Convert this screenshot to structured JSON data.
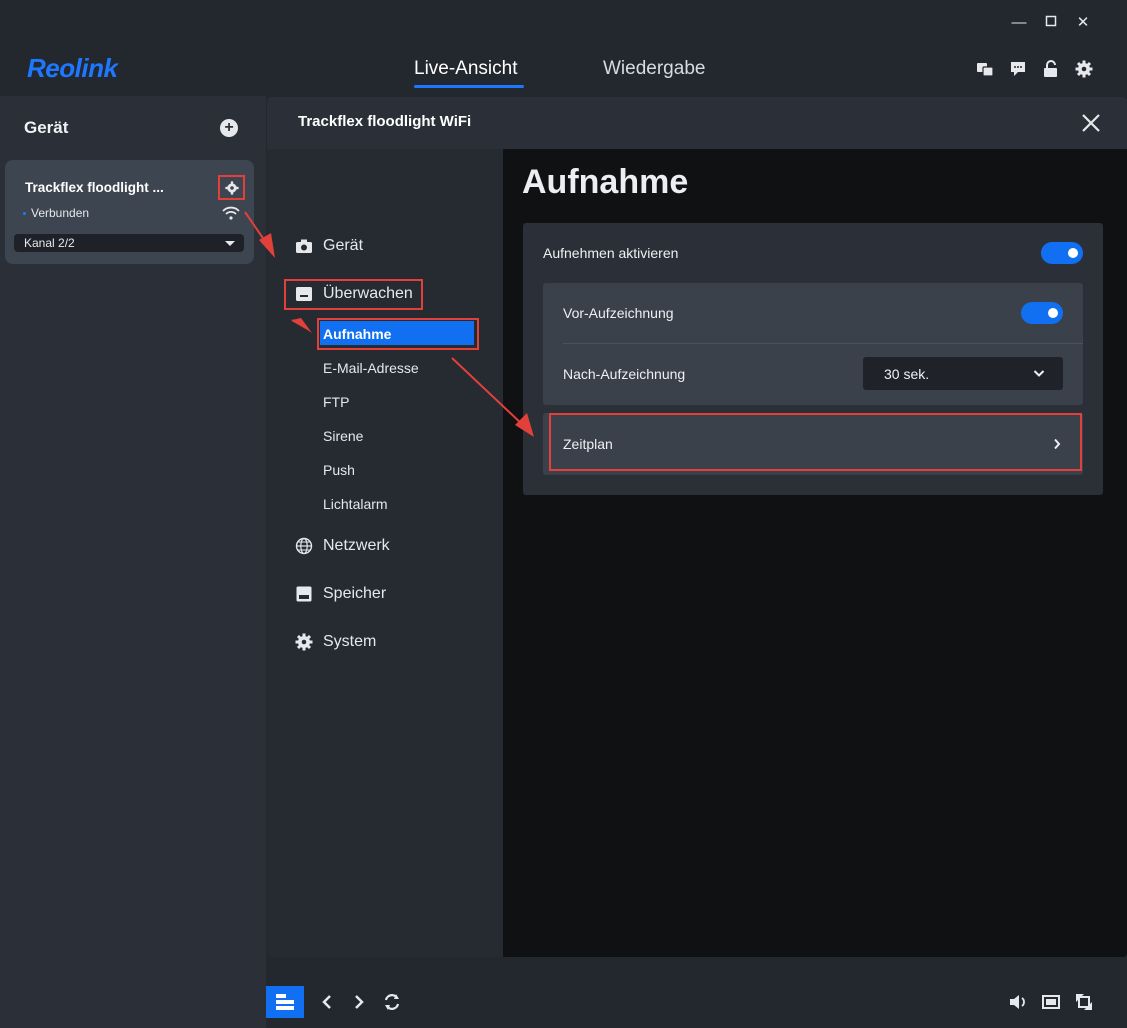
{
  "window": {
    "minimize": "—",
    "maximize": "☐",
    "close": "✕"
  },
  "header": {
    "logo": "Reolink",
    "tabs": [
      {
        "label": "Live-Ansicht",
        "active": true
      },
      {
        "label": "Wiedergabe",
        "active": false
      }
    ],
    "icons": [
      "translate-icon",
      "message-icon",
      "unlock-icon",
      "settings-icon"
    ]
  },
  "sidebar": {
    "title": "Gerät",
    "device": {
      "name": "Trackflex floodlight ...",
      "status": "Verbunden",
      "channel": "Kanal 2/2"
    }
  },
  "modal": {
    "title": "Trackflex floodlight WiFi",
    "menu": {
      "geraet": "Gerät",
      "ueberwachen": "Überwachen",
      "sub": [
        "Aufnahme",
        "E-Mail-Adresse",
        "FTP",
        "Sirene",
        "Push",
        "Lichtalarm"
      ],
      "netzwerk": "Netzwerk",
      "speicher": "Speicher",
      "system": "System"
    },
    "page": {
      "title": "Aufnahme",
      "record_enable_label": "Aufnehmen aktivieren",
      "record_enable_on": true,
      "pre_record_label": "Vor-Aufzeichnung",
      "pre_record_on": true,
      "post_record_label": "Nach-Aufzeichnung",
      "post_record_value": "30 sek.",
      "schedule_label": "Zeitplan"
    }
  },
  "colors": {
    "accent": "#1170f2",
    "brand": "#1e78ff",
    "highlight": "#e2413b"
  }
}
